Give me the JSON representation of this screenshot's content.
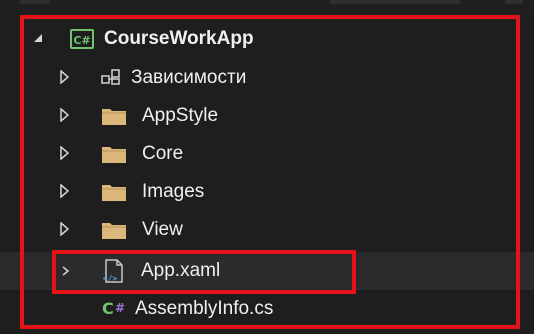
{
  "solution_explorer": {
    "project": {
      "name": "CourseWorkApp",
      "icon": "csharp-project-icon",
      "icon_text": "C#",
      "expanded": true
    },
    "items": [
      {
        "label": "Зависимости",
        "icon": "dependencies-icon",
        "expandable": true
      },
      {
        "label": "AppStyle",
        "icon": "folder-icon",
        "expandable": true
      },
      {
        "label": "Core",
        "icon": "folder-icon",
        "expandable": true
      },
      {
        "label": "Images",
        "icon": "folder-icon",
        "expandable": true
      },
      {
        "label": "View",
        "icon": "folder-icon",
        "expandable": true
      },
      {
        "label": "App.xaml",
        "icon": "xaml-file-icon",
        "expandable": true,
        "hovered": true
      },
      {
        "label": "AssemblyInfo.cs",
        "icon": "csharp-file-icon",
        "icon_text": "C#",
        "expandable": false
      }
    ]
  },
  "colors": {
    "background": "#1e1e1e",
    "highlight_row": "#2b2b2b",
    "annotation_red": "#e6121a",
    "folder": "#dcb67a",
    "csharp_green": "#6fc36f",
    "csharp_purple": "#9b73d9",
    "xaml_blue": "#4fa3e0"
  }
}
